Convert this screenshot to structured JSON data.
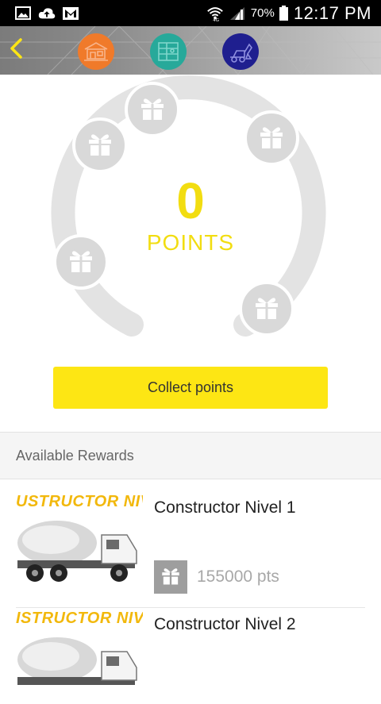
{
  "status_bar": {
    "battery_percent": "70%",
    "time": "12:17 PM",
    "icons": [
      "gallery-icon",
      "cloud-upload-icon",
      "gmail-icon",
      "wifi-icon",
      "signal-icon",
      "battery-icon"
    ]
  },
  "header": {
    "back_icon": "chevron-left-icon",
    "level_icons": [
      {
        "name": "level-1-icon",
        "color": "#f07a2a"
      },
      {
        "name": "level-2-icon",
        "color": "#27a99a"
      },
      {
        "name": "level-3-icon",
        "color": "#1f1f8f"
      }
    ]
  },
  "points": {
    "value": "0",
    "label": "POINTS"
  },
  "colors": {
    "accent_yellow": "#fde614",
    "points_yellow": "#f2dd11",
    "gauge_gray": "#e3e3e3",
    "gift_gray": "#d9d9d9"
  },
  "actions": {
    "collect_label": "Collect points"
  },
  "rewards": {
    "section_title": "Available Rewards",
    "items": [
      {
        "banner": "USTRUCTOR NIVE",
        "title": "Constructor Nivel 1",
        "points": "155000 pts"
      },
      {
        "banner": "ISTRUCTOR NIVE",
        "title": "Constructor Nivel 2"
      }
    ]
  }
}
